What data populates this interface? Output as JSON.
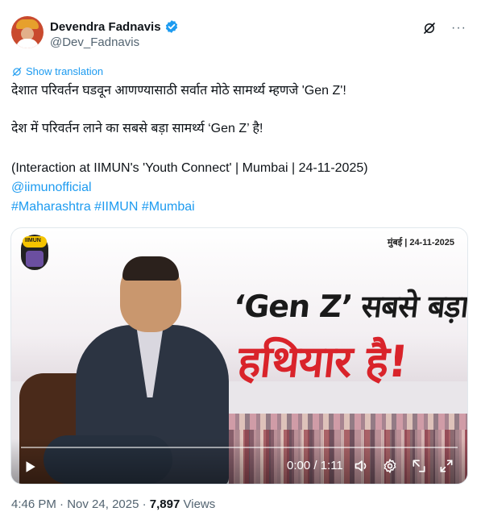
{
  "author": {
    "name": "Devendra Fadnavis",
    "handle": "@Dev_Fadnavis"
  },
  "header_icons": [
    "grok-icon",
    "more-icon"
  ],
  "more_label": "···",
  "translate_label": "Show translation",
  "post": {
    "line1": "देशात परिवर्तन घडवून आणण्यासाठी सर्वात मोठे सामर्थ्य म्हणजे 'Gen Z'!",
    "line2": "देश में परिवर्तन लाने का सबसे बड़ा सामर्थ्य ‘Gen Z’ है!",
    "line3": "(Interaction at IIMUN's 'Youth Connect' | Mumbai | 24-11-2025)",
    "mention": "@iimunofficial",
    "hashtags": [
      "#Maharashtra",
      "#IIMUN",
      "#Mumbai"
    ]
  },
  "video": {
    "logo_text": "IIMUN",
    "place_date": "मुंबई | 24-11-2025",
    "headline1": "‘Gen Z’ सबसे बड़ा",
    "headline2": "हथियार है!",
    "time": "0:00 / 1:11",
    "progress": 0
  },
  "meta": {
    "time": "4:46 PM",
    "date": "Nov 24, 2025",
    "views_count": "7,897",
    "views_label": "Views",
    "sep": "·"
  },
  "colors": {
    "link": "#1d9bf0",
    "verified": "#1d9bf0",
    "headline_red": "#d9232a"
  }
}
